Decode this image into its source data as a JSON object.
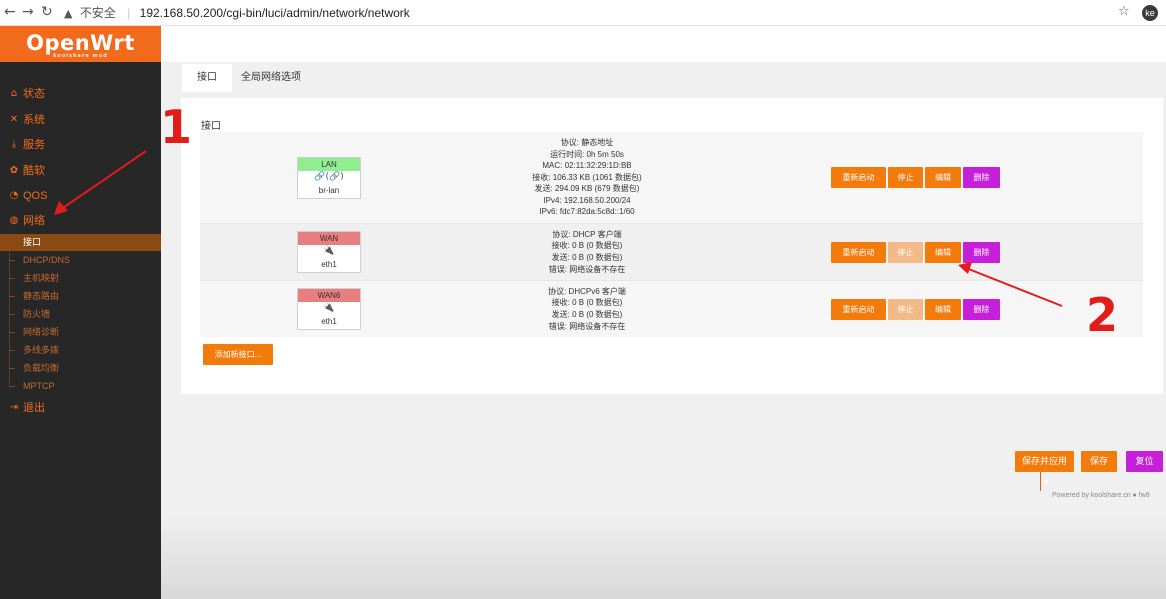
{
  "browser": {
    "back_icon": "arrow-left-icon",
    "forward_icon": "arrow-right-icon",
    "reload_icon": "reload-icon",
    "insecure_label": "不安全",
    "url": "192.168.50.200/cgi-bin/luci/admin/network/network",
    "profile_initials": "ke"
  },
  "logo": {
    "text": "OpenWrt",
    "subtitle": "koolshare mod"
  },
  "sidebar": {
    "items": [
      {
        "label": "状态",
        "icon": "home-icon"
      },
      {
        "label": "系统",
        "icon": "tools-icon"
      },
      {
        "label": "服务",
        "icon": "download-icon"
      },
      {
        "label": "酷软",
        "icon": "cog-icon"
      },
      {
        "label": "QOS",
        "icon": "gauge-icon"
      },
      {
        "label": "网络",
        "icon": "globe-icon"
      },
      {
        "label": "退出",
        "icon": "logout-icon"
      }
    ],
    "network_sub": [
      {
        "label": "接口",
        "active": true
      },
      {
        "label": "DHCP/DNS"
      },
      {
        "label": "主机映射"
      },
      {
        "label": "静态路由"
      },
      {
        "label": "防火墙"
      },
      {
        "label": "网络诊断"
      },
      {
        "label": "多线多拨"
      },
      {
        "label": "负载均衡"
      },
      {
        "label": "MPTCP"
      }
    ]
  },
  "tabs": [
    {
      "label": "接口",
      "active": true
    },
    {
      "label": "全局网络选项"
    }
  ],
  "panel": {
    "title": "接口",
    "interfaces": [
      {
        "name": "LAN",
        "status_color": "#90ee90",
        "icon_text": "🔗(🔗)",
        "device": "br-lan",
        "info": [
          "协议: 静态地址",
          "运行时间: 0h 5m 50s",
          "MAC: 02:11:32:29:1D:BB",
          "接收: 106.33 KB (1061 数据包)",
          "发送: 294.09 KB (679 数据包)",
          "IPv4: 192.168.50.200/24",
          "IPv6: fdc7:82da:5c8d::1/60"
        ],
        "stop_enabled": true
      },
      {
        "name": "WAN",
        "status_color": "#e87f7f",
        "icon_text": "🔌",
        "device": "eth1",
        "info": [
          "协议: DHCP 客户端",
          "接收: 0 B (0 数据包)",
          "发送: 0 B (0 数据包)",
          "错误: 网络设备不存在"
        ],
        "stop_enabled": false
      },
      {
        "name": "WAN6",
        "status_color": "#e87f7f",
        "icon_text": "🔌",
        "device": "eth1",
        "info": [
          "协议: DHCPv6 客户端",
          "接收: 0 B (0 数据包)",
          "发送: 0 B (0 数据包)",
          "错误: 网络设备不存在"
        ],
        "stop_enabled": false
      }
    ],
    "actions": {
      "restart": "重新启动",
      "stop": "停止",
      "edit": "编辑",
      "delete": "删除"
    },
    "add_button": "添加新接口..."
  },
  "footer": {
    "save_apply": "保存并应用",
    "save": "保存",
    "reset": "复位",
    "powered": "Powered by koolshare.cn ● fw8"
  },
  "annotations": {
    "one": "1",
    "two": "2",
    "color": "#e21b1b"
  }
}
